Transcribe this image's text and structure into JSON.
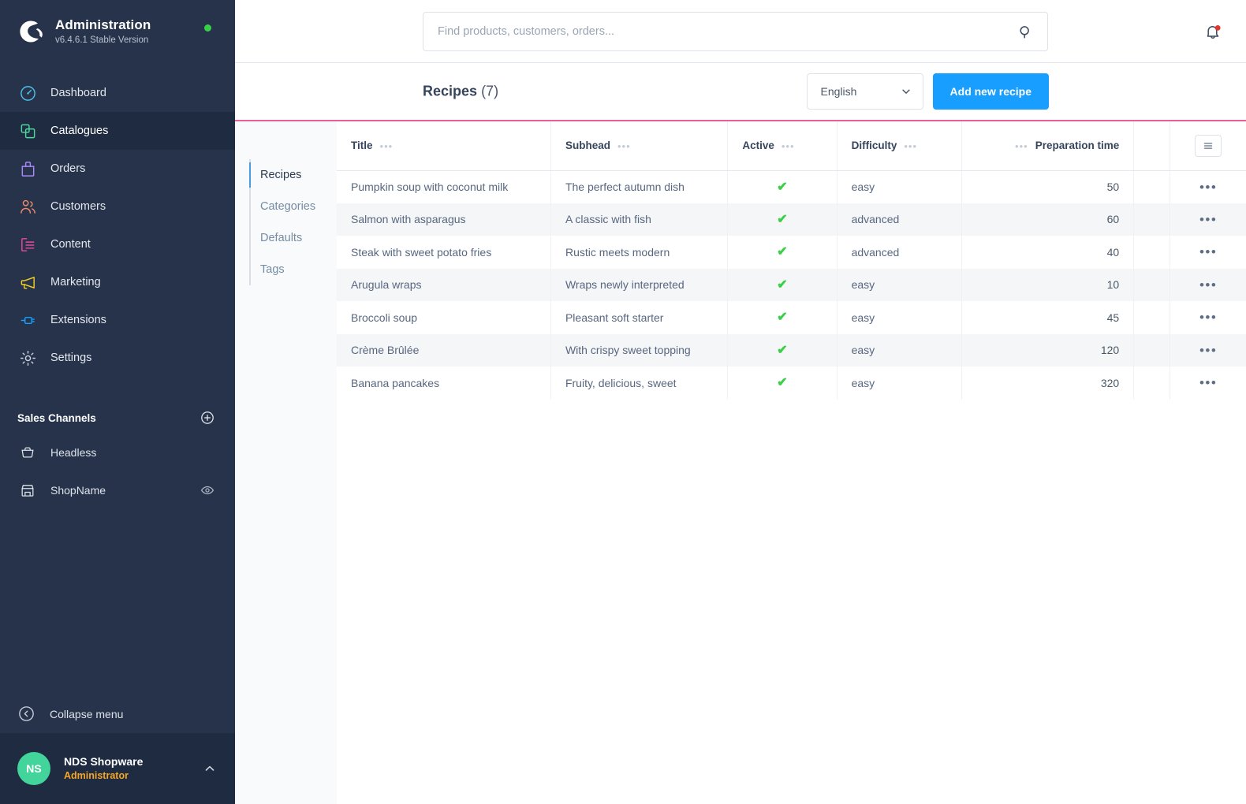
{
  "sidebar": {
    "brand": {
      "title": "Administration",
      "version": "v6.4.6.1 Stable Version",
      "logo_icon": "shopware-logo-icon",
      "status_dot_color": "#37d046"
    },
    "nav_items": [
      {
        "label": "Dashboard",
        "icon": "dashboard-gauge-icon",
        "color": "#4ec0e8",
        "active": false
      },
      {
        "label": "Catalogues",
        "icon": "catalogues-copy-icon",
        "color": "#4ed8a0",
        "active": true
      },
      {
        "label": "Orders",
        "icon": "orders-bag-icon",
        "color": "#a78bfa",
        "active": false
      },
      {
        "label": "Customers",
        "icon": "customers-people-icon",
        "color": "#ef8b6a",
        "active": false
      },
      {
        "label": "Content",
        "icon": "content-layout-icon",
        "color": "#ec4899",
        "active": false
      },
      {
        "label": "Marketing",
        "icon": "marketing-megaphone-icon",
        "color": "#f2d024",
        "active": false
      },
      {
        "label": "Extensions",
        "icon": "extensions-plug-icon",
        "color": "#189eff",
        "active": false
      },
      {
        "label": "Settings",
        "icon": "settings-gear-icon",
        "color": "#c9d2de",
        "active": false
      }
    ],
    "sales_channels": {
      "title": "Sales Channels",
      "add_icon": "plus-circle-icon",
      "items": [
        {
          "label": "Headless",
          "icon": "basket-icon",
          "trailing_icon": null
        },
        {
          "label": "ShopName",
          "icon": "storefront-icon",
          "trailing_icon": "eye-icon"
        }
      ]
    },
    "collapse": {
      "label": "Collapse menu",
      "icon": "chevron-left-circle-icon"
    },
    "user": {
      "initials": "NS",
      "name": "NDS Shopware",
      "role": "Administrator",
      "caret_icon": "chevron-up-icon",
      "avatar_color": "#42d49a",
      "role_color": "#f5a623"
    }
  },
  "topbar": {
    "search": {
      "placeholder": "Find products, customers, orders...",
      "value": "",
      "icon": "search-icon"
    },
    "notifications": {
      "icon": "bell-icon",
      "has_badge": true,
      "badge_color": "#e3342f"
    }
  },
  "pagehead": {
    "title": "Recipes",
    "count": "(7)",
    "language": {
      "label": "English",
      "caret_icon": "chevron-down-icon"
    },
    "add_button": "Add new recipe",
    "accent_color": "#e95d9a",
    "primary_color": "#189eff"
  },
  "subnav": {
    "items": [
      {
        "label": "Recipes",
        "active": true
      },
      {
        "label": "Categories",
        "active": false
      },
      {
        "label": "Defaults",
        "active": false
      },
      {
        "label": "Tags",
        "active": false
      }
    ]
  },
  "table": {
    "columns": [
      {
        "label": "Title",
        "align": "left",
        "menu": true
      },
      {
        "label": "Subhead",
        "align": "left",
        "menu": true
      },
      {
        "label": "Active",
        "align": "left",
        "menu": true
      },
      {
        "label": "Difficulty",
        "align": "left",
        "menu": true
      },
      {
        "label": "Preparation time",
        "align": "right",
        "menu": true
      }
    ],
    "config_icon": "list-settings-icon",
    "row_action_icon": "ellipsis-icon",
    "active_check_icon": "check-icon",
    "rows": [
      {
        "title": "Pumpkin soup with coconut milk",
        "subhead": "The perfect autumn dish",
        "active": true,
        "difficulty": "easy",
        "preparation_time": "50"
      },
      {
        "title": "Salmon with asparagus",
        "subhead": "A classic with fish",
        "active": true,
        "difficulty": "advanced",
        "preparation_time": "60"
      },
      {
        "title": "Steak with sweet potato fries",
        "subhead": "Rustic meets modern",
        "active": true,
        "difficulty": "advanced",
        "preparation_time": "40"
      },
      {
        "title": "Arugula wraps",
        "subhead": "Wraps newly interpreted",
        "active": true,
        "difficulty": "easy",
        "preparation_time": "10"
      },
      {
        "title": "Broccoli soup",
        "subhead": "Pleasant soft starter",
        "active": true,
        "difficulty": "easy",
        "preparation_time": "45"
      },
      {
        "title": "Crème Brûlée",
        "subhead": "With crispy sweet topping",
        "active": true,
        "difficulty": "easy",
        "preparation_time": "120"
      },
      {
        "title": "Banana pancakes",
        "subhead": "Fruity, delicious, sweet",
        "active": true,
        "difficulty": "easy",
        "preparation_time": "320"
      }
    ]
  }
}
